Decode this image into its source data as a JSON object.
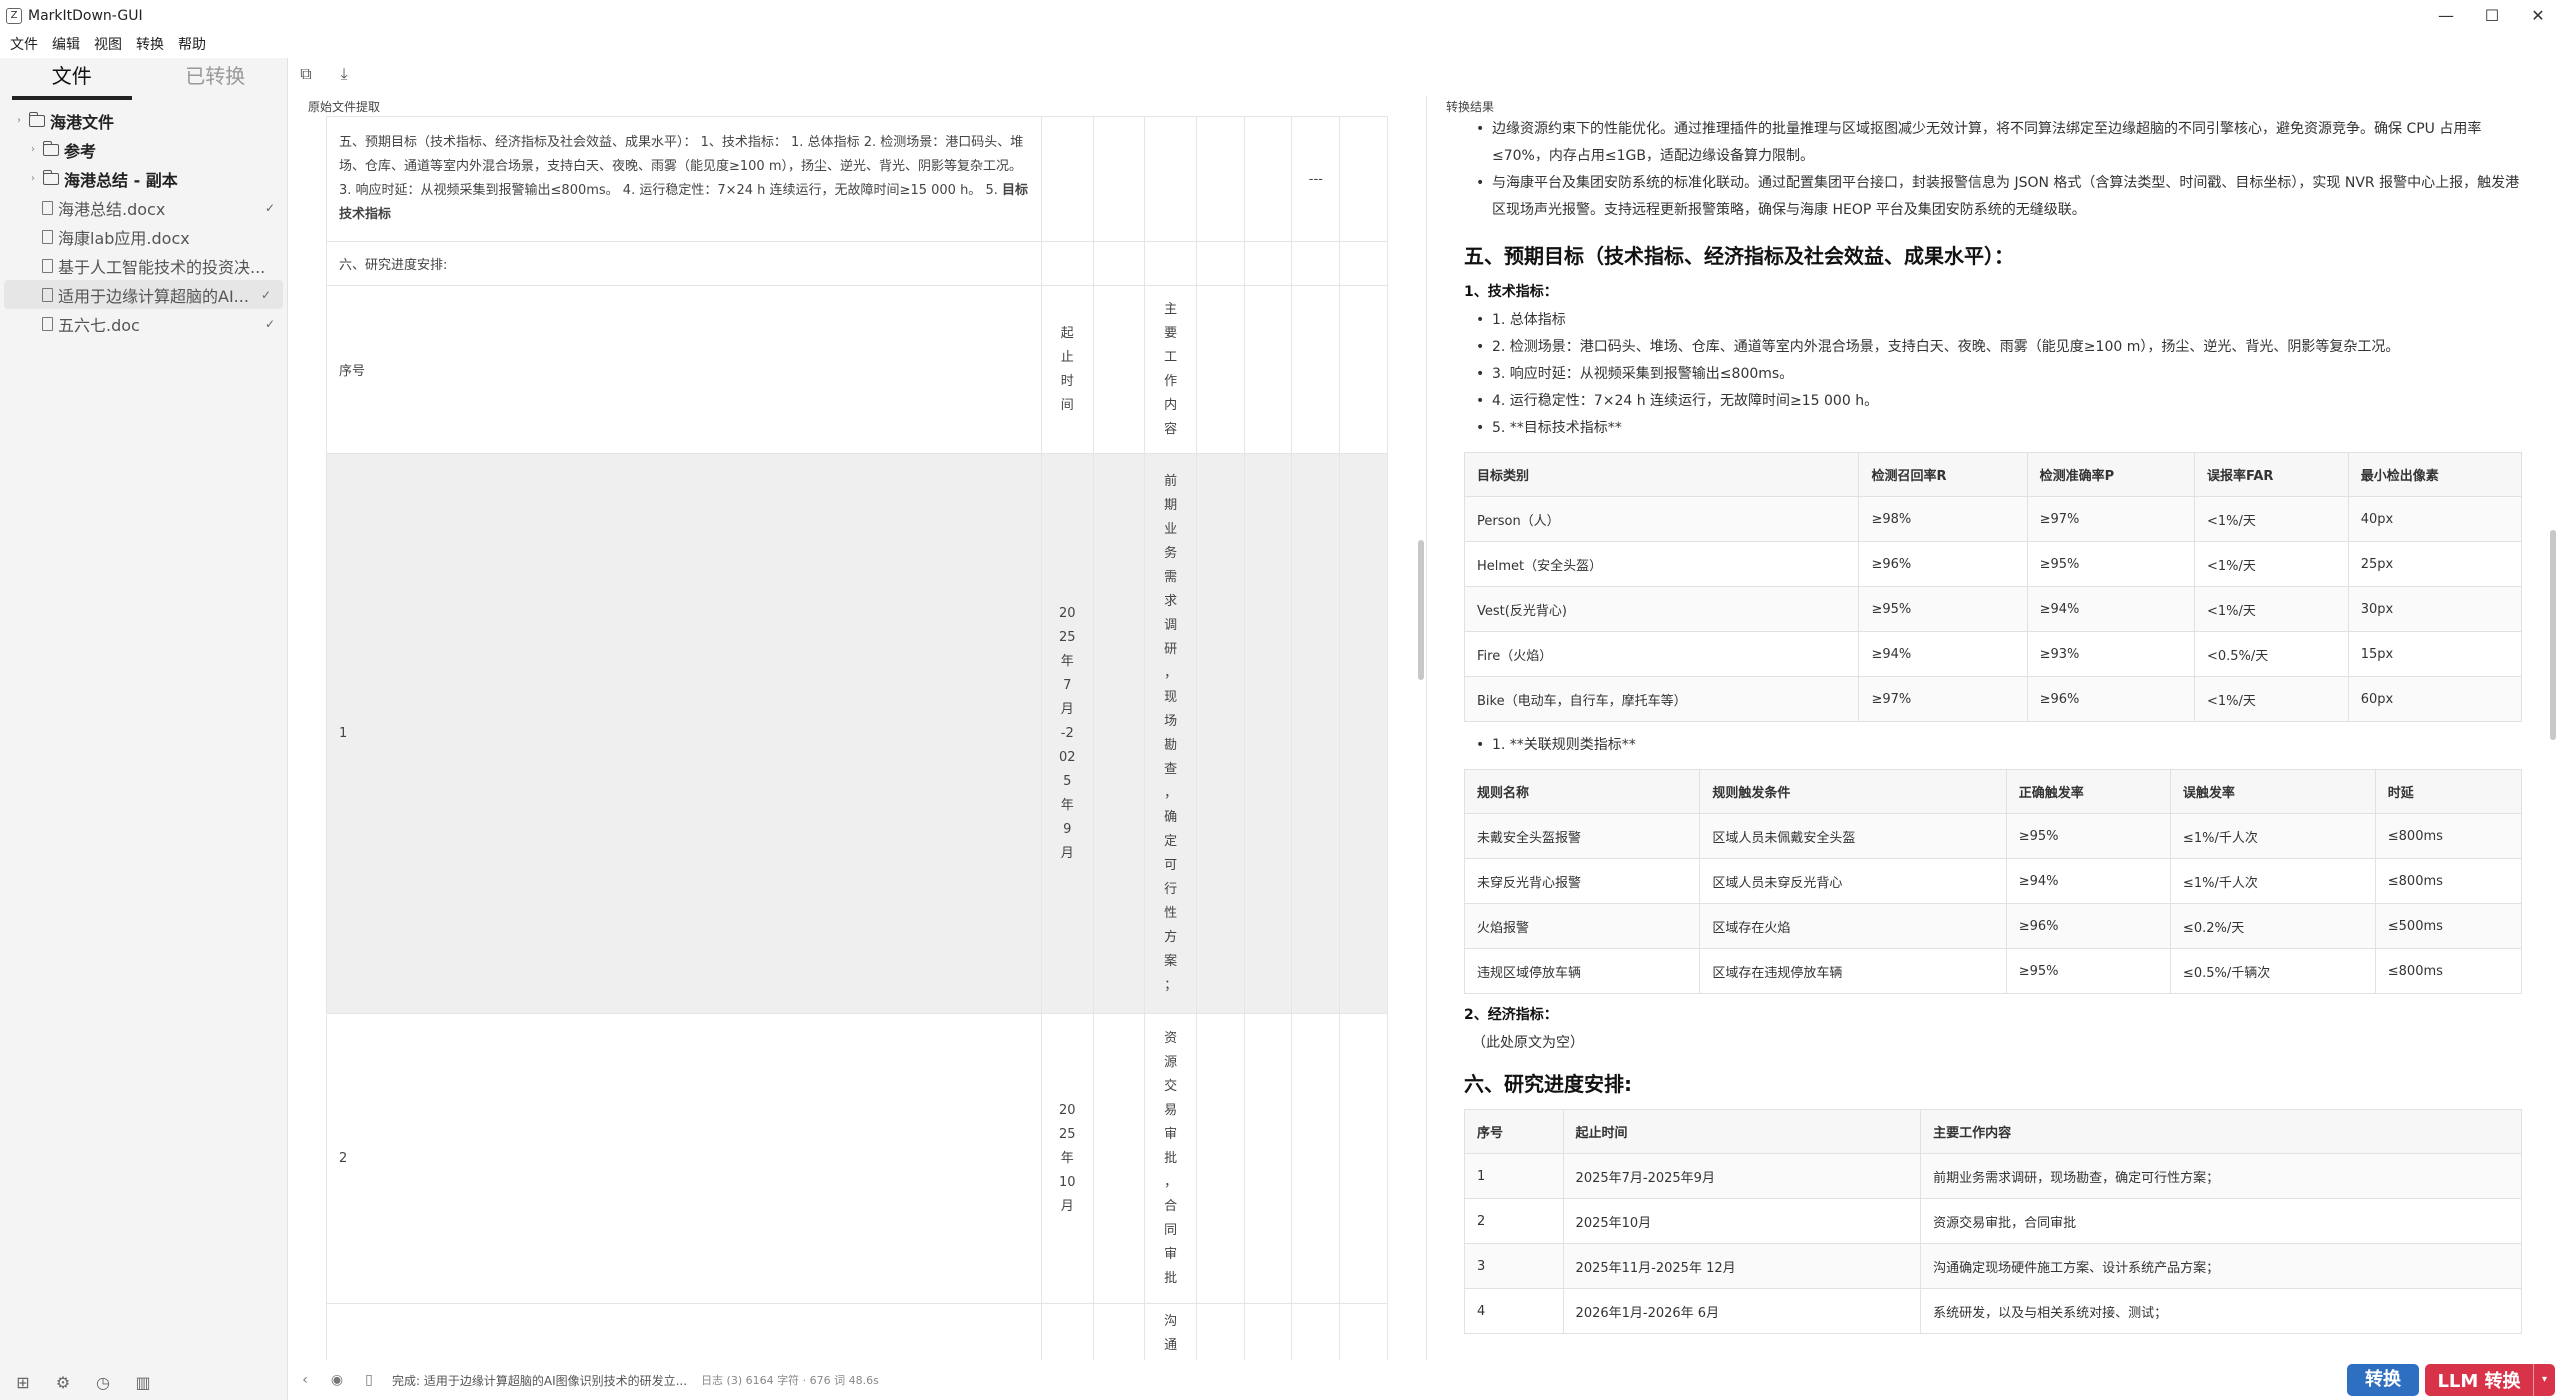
{
  "window": {
    "title": "MarkItDown-GUI",
    "icon": "Z",
    "min": "—",
    "max": "☐",
    "close": "✕"
  },
  "menu": [
    "文件",
    "编辑",
    "视图",
    "转换",
    "帮助"
  ],
  "sidebar": {
    "tab_files": "文件",
    "tab_converted": "已转换",
    "tree": [
      {
        "label": "海港文件",
        "type": "folder",
        "bold": true,
        "indent": 0,
        "check": ""
      },
      {
        "label": "参考",
        "type": "folder",
        "bold": true,
        "indent": 1,
        "check": ""
      },
      {
        "label": "海港总结 - 副本",
        "type": "folder",
        "bold": true,
        "indent": 1,
        "check": ""
      },
      {
        "label": "海港总结.docx",
        "type": "file",
        "indent": 2,
        "check": "✓"
      },
      {
        "label": "海康lab应用.docx",
        "type": "file",
        "indent": 2,
        "check": ""
      },
      {
        "label": "基于人工智能技术的投资决...",
        "type": "file",
        "indent": 2,
        "check": ""
      },
      {
        "label": "适用于边缘计算超脑的AI...",
        "type": "file",
        "indent": 2,
        "check": "✓",
        "selected": true
      },
      {
        "label": "五六七.doc",
        "type": "file",
        "indent": 2,
        "check": "✓"
      }
    ]
  },
  "left": {
    "panel_label": "原始文件提取",
    "row1_text": "五、预期目标（技术指标、经济指标及社会效益、成果水平）： 1、技术指标： 1. 总体指标 2. 检测场景：港口码头、堆场、仓库、通道等室内外混合场景，支持白天、夜晚、雨雾（能见度≥100 m），扬尘、逆光、背光、阴影等复杂工况。 3. 响应时延：从视频采集到报警输出≤800ms。 4. 运行稳定性：7×24 h 连续运行，无故障时间≥15 000 h。 5. ",
    "row1_bold": "目标技术指标",
    "row1_dash": "---",
    "row2_text": "六、研究进度安排:",
    "header_seq": "序号",
    "header_time": "起止时间",
    "header_content": "主要工作内容",
    "row_1_seq": "1",
    "row_1_time": "2025年7月-2025年9月",
    "row_1_content": "前期业务需求调研，现场勘查，确定可行性方案；",
    "row_2_seq": "2",
    "row_2_time": "2025年10月",
    "row_2_content": "资源交易审批，合同审批",
    "row_3_content": "沟通"
  },
  "right": {
    "panel_label": "转换结果",
    "top_bullets": [
      "边缘资源约束下的性能优化。通过推理插件的批量推理与区域抠图减少无效计算，将不同算法绑定至边缘超脑的不同引擎核心，避免资源竞争。确保 CPU 占用率≤70%，内存占用≤1GB，适配边缘设备算力限制。",
      "与海康平台及集团安防系统的标准化联动。通过配置集团平台接口，封装报警信息为 JSON 格式（含算法类型、时间戳、目标坐标），实现 NVR 报警中心上报，触发港区现场声光报警。支持远程更新报警策略，确保与海康 HEOP 平台及集团安防系统的无缝级联。"
    ],
    "h5": "五、预期目标（技术指标、经济指标及社会效益、成果水平）：",
    "h_tech": "1、技术指标：",
    "tech_list": [
      "1. 总体指标",
      "2. 检测场景：港口码头、堆场、仓库、通道等室内外混合场景，支持白天、夜晚、雨雾（能见度≥100 m），扬尘、逆光、背光、阴影等复杂工况。",
      "3. 响应时延：从视频采集到报警输出≤800ms。",
      "4. 运行稳定性：7×24 h 连续运行，无故障时间≥15 000 h。",
      "5. **目标技术指标**"
    ],
    "table1": {
      "headers": [
        "目标类别",
        "检测召回率R",
        "检测准确率P",
        "误报率FAR",
        "最小检出像素"
      ],
      "rows": [
        [
          "Person（人）",
          "≥98%",
          "≥97%",
          "<1%/天",
          "40px"
        ],
        [
          "Helmet（安全头盔）",
          "≥96%",
          "≥95%",
          "<1%/天",
          "25px"
        ],
        [
          "Vest(反光背心)",
          "≥95%",
          "≥94%",
          "<1%/天",
          "30px"
        ],
        [
          "Fire（火焰）",
          "≥94%",
          "≥93%",
          "<0.5%/天",
          "15px"
        ],
        [
          "Bike（电动车，自行车，摩托车等）",
          "≥97%",
          "≥96%",
          "<1%/天",
          "60px"
        ]
      ]
    },
    "rule_bullet": "1. **关联规则类指标**",
    "table2": {
      "headers": [
        "规则名称",
        "规则触发条件",
        "正确触发率",
        "误触发率",
        "时延"
      ],
      "rows": [
        [
          "未戴安全头盔报警",
          "区域人员未佩戴安全头盔",
          "≥95%",
          "≤1%/千人次",
          "≤800ms"
        ],
        [
          "未穿反光背心报警",
          "区域人员未穿反光背心",
          "≥94%",
          "≤1%/千人次",
          "≤800ms"
        ],
        [
          "火焰报警",
          "区域存在火焰",
          "≥96%",
          "≤0.2%/天",
          "≤500ms"
        ],
        [
          "违规区域停放车辆",
          "区域存在违规停放车辆",
          "≥95%",
          "≤0.5%/千辆次",
          "≤800ms"
        ]
      ]
    },
    "h_econ": "2、经济指标：",
    "econ_empty": "（此处原文为空）",
    "h6": "六、研究进度安排:",
    "table3": {
      "headers": [
        "序号",
        "起止时间",
        "主要工作内容"
      ],
      "rows": [
        [
          "1",
          "2025年7月-2025年9月",
          "前期业务需求调研，现场勘查，确定可行性方案；"
        ],
        [
          "2",
          "2025年10月",
          "资源交易审批，合同审批"
        ],
        [
          "3",
          "2025年11月-2025年 12月",
          "沟通确定现场硬件施工方案、设计系统产品方案；"
        ],
        [
          "4",
          "2026年1月-2026年 6月",
          "系统研发，以及与相关系统对接、测试；"
        ]
      ]
    }
  },
  "status": {
    "text": "完成: 适用于边缘计算超脑的AI图像识别技术的研发立...",
    "meta": "日志 (3)   6164 字符 · 676 词 48.6s"
  },
  "buttons": {
    "convert": "转换",
    "llm": "LLM 转换",
    "dropdown": "▾"
  }
}
